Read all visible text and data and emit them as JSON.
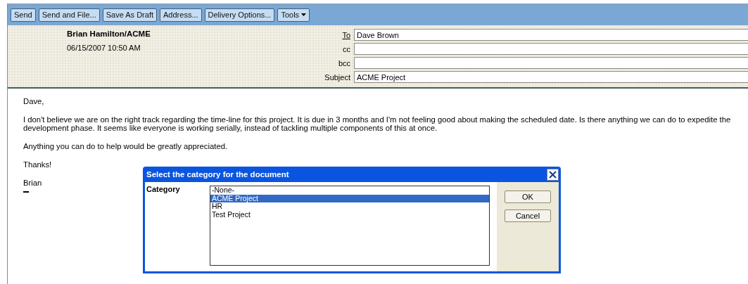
{
  "toolbar": {
    "buttons": [
      {
        "label": "Send",
        "kind": "plain"
      },
      {
        "label": "Send and File...",
        "kind": "plain"
      },
      {
        "label": "Save As Draft",
        "kind": "plain"
      },
      {
        "label": "Address...",
        "kind": "plain"
      },
      {
        "label": "Delivery Options...",
        "kind": "plain"
      },
      {
        "label": "Tools",
        "kind": "menu"
      }
    ]
  },
  "header": {
    "sender": "Brian Hamilton/ACME",
    "date": "06/15/2007 10:50 AM",
    "fields": [
      {
        "label": "To",
        "kind": "link",
        "value": "Dave Brown"
      },
      {
        "label": "cc",
        "kind": "plain"
      },
      {
        "label": "bcc",
        "kind": "plain"
      },
      {
        "label": "Subject",
        "kind": "plain",
        "value": "ACME Project"
      }
    ]
  },
  "body": {
    "paragraphs": [
      "Dave,",
      "I don't believe we are on the right track regarding the time-line for this project. It is due in 3 months and I'm not feeling good about making the scheduled date. Is there anything we can do to expedite the development phase. It seems like everyone is working serially, instead of tackling multiple components of this at once.",
      "Anything you can do to help would be greatly appreciated.",
      "Thanks!",
      "Brian"
    ]
  },
  "dialog": {
    "title": "Select the category for the document",
    "label": "Category",
    "options": [
      {
        "label": "-None-",
        "selected": false
      },
      {
        "label": "ACME Project",
        "selected": true
      },
      {
        "label": "HR",
        "selected": false
      },
      {
        "label": "Test Project",
        "selected": false
      }
    ],
    "buttons": [
      "OK",
      "Cancel"
    ]
  }
}
